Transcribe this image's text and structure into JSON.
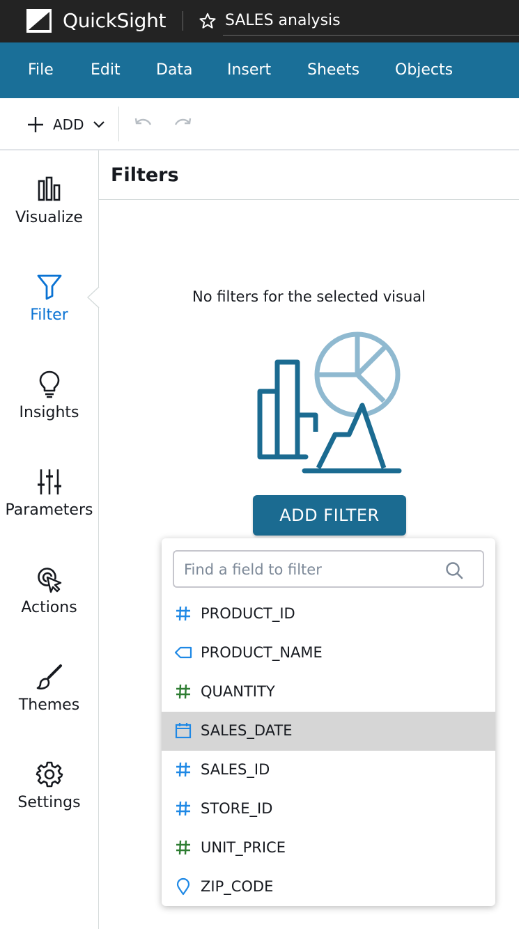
{
  "app": {
    "brand": "QuickSight",
    "analysis_title": "SALES analysis"
  },
  "menu": [
    "File",
    "Edit",
    "Data",
    "Insert",
    "Sheets",
    "Objects"
  ],
  "toolbar": {
    "add_label": "ADD"
  },
  "sidebar": {
    "items": [
      {
        "label": "Visualize",
        "icon": "bar-chart-icon",
        "active": false
      },
      {
        "label": "Filter",
        "icon": "funnel-icon",
        "active": true
      },
      {
        "label": "Insights",
        "icon": "lightbulb-icon",
        "active": false
      },
      {
        "label": "Parameters",
        "icon": "sliders-icon",
        "active": false
      },
      {
        "label": "Actions",
        "icon": "pointer-click-icon",
        "active": false
      },
      {
        "label": "Themes",
        "icon": "paintbrush-icon",
        "active": false
      },
      {
        "label": "Settings",
        "icon": "gear-icon",
        "active": false
      }
    ]
  },
  "panel": {
    "title": "Filters",
    "empty_message": "No filters for the selected visual",
    "add_filter_label": "ADD FILTER"
  },
  "dropdown": {
    "search_placeholder": "Find a field to filter",
    "search_value": "",
    "highlighted": "SALES_DATE",
    "fields": [
      {
        "name": "PRODUCT_ID",
        "type": "numeric-dimension",
        "icon": "hash-icon",
        "color": "#1e88e5"
      },
      {
        "name": "PRODUCT_NAME",
        "type": "string",
        "icon": "tag-icon",
        "color": "#1e88e5"
      },
      {
        "name": "QUANTITY",
        "type": "numeric-measure",
        "icon": "hash-icon",
        "color": "#2e7d32"
      },
      {
        "name": "SALES_DATE",
        "type": "date",
        "icon": "calendar-icon",
        "color": "#1e88e5"
      },
      {
        "name": "SALES_ID",
        "type": "numeric-dimension",
        "icon": "hash-icon",
        "color": "#1e88e5"
      },
      {
        "name": "STORE_ID",
        "type": "numeric-dimension",
        "icon": "hash-icon",
        "color": "#1e88e5"
      },
      {
        "name": "UNIT_PRICE",
        "type": "numeric-measure",
        "icon": "hash-icon",
        "color": "#2e7d32"
      },
      {
        "name": "ZIP_CODE",
        "type": "geospatial",
        "icon": "map-pin-icon",
        "color": "#1e88e5"
      }
    ]
  },
  "colors": {
    "topbar": "#232323",
    "menubar": "#1a6f98",
    "accent": "#0972d3",
    "button": "#1b6b91",
    "dimension": "#1e88e5",
    "measure": "#2e7d32"
  }
}
